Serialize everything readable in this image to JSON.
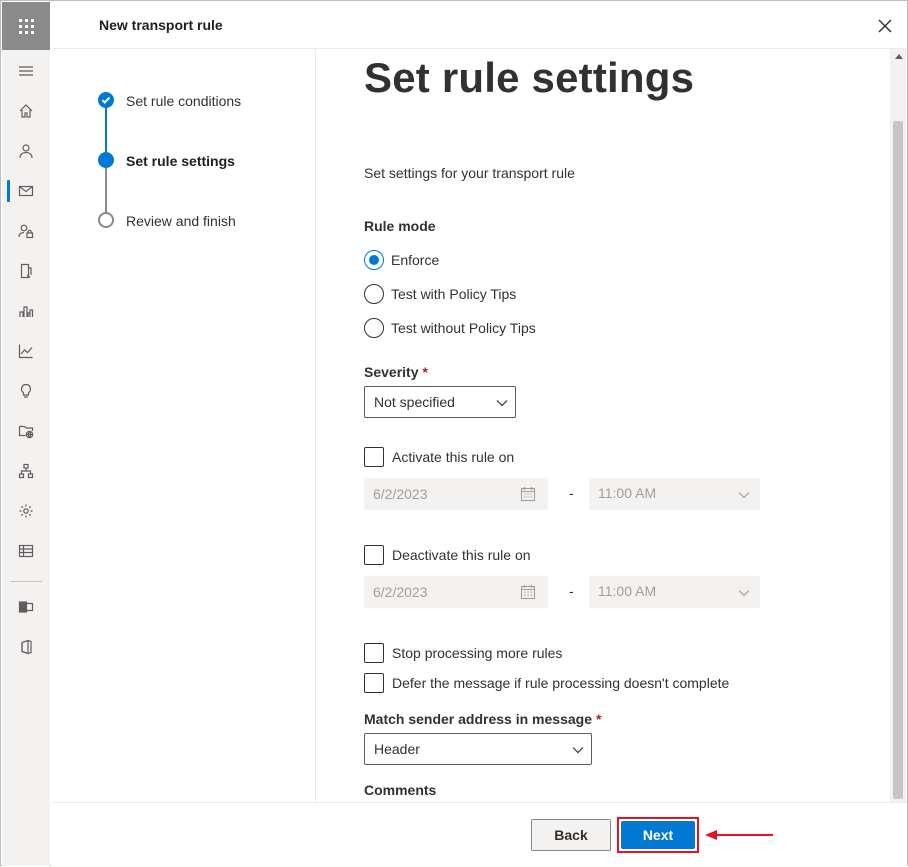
{
  "panel": {
    "title": "New transport rule",
    "close_icon": "close-icon"
  },
  "steps": [
    {
      "label": "Set rule conditions",
      "state": "completed"
    },
    {
      "label": "Set rule settings",
      "state": "current"
    },
    {
      "label": "Review and finish",
      "state": "pending"
    }
  ],
  "content": {
    "heading": "Set rule settings",
    "description": "Set settings for your transport rule",
    "rule_mode": {
      "label": "Rule mode",
      "options": [
        "Enforce",
        "Test with Policy Tips",
        "Test without Policy Tips"
      ],
      "selected": "Enforce"
    },
    "severity": {
      "label": "Severity",
      "required_mark": "*",
      "value": "Not specified"
    },
    "activate": {
      "label": "Activate this rule on",
      "checked": false,
      "date": "6/2/2023",
      "separator": "-",
      "time": "11:00 AM"
    },
    "deactivate": {
      "label": "Deactivate this rule on",
      "checked": false,
      "date": "6/2/2023",
      "separator": "-",
      "time": "11:00 AM"
    },
    "stop_processing": {
      "label": "Stop processing more rules",
      "checked": false
    },
    "defer_message": {
      "label": "Defer the message if rule processing doesn't complete",
      "checked": false
    },
    "match_sender": {
      "label": "Match sender address in message",
      "required_mark": "*",
      "value": "Header"
    },
    "comments_label": "Comments"
  },
  "footer": {
    "back_label": "Back",
    "next_label": "Next"
  },
  "colors": {
    "accent": "#0078d4",
    "highlight": "#e81123",
    "required": "#a4262c"
  }
}
